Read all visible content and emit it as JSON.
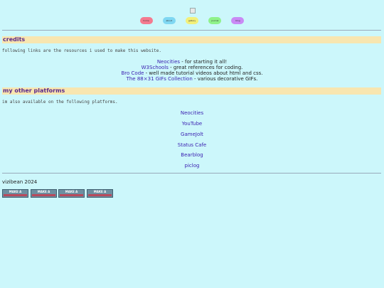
{
  "nav": [
    {
      "label": "home",
      "color": "#f47a8f"
    },
    {
      "label": "about",
      "color": "#7fd7f2"
    },
    {
      "label": "gallery",
      "color": "#f2f07a"
    },
    {
      "label": "journal",
      "color": "#8ff28a"
    },
    {
      "label": "blog",
      "color": "#c98af5"
    }
  ],
  "credits": {
    "heading": "credits",
    "intro": "following links are the resources i used to make this website.",
    "items": [
      {
        "link": "Neocities",
        "desc": " - for starting it all!"
      },
      {
        "link": "W3Schools",
        "desc": " - great references for coding."
      },
      {
        "link": "Bro Code",
        "desc": " - well made tutorial videos about html and css."
      },
      {
        "link": "The 88×31 GIFs Collection",
        "desc": " - various decorative GIFs."
      }
    ]
  },
  "platforms": {
    "heading": "my other platforms",
    "intro": "im also available on the following platforms.",
    "items": [
      "Neocities",
      "YouTube",
      "GameJolt",
      "Status Cafe",
      "Bearblog",
      "piclog"
    ]
  },
  "footer": {
    "text": "vizibean 2024",
    "badges": [
      "MAKE A",
      "MAKE A",
      "MAKE A",
      "MAKE A"
    ]
  },
  "colors": {
    "background": "#ccf7fb",
    "section_head": "#f8e6b0",
    "link": "#3a1fb0"
  }
}
